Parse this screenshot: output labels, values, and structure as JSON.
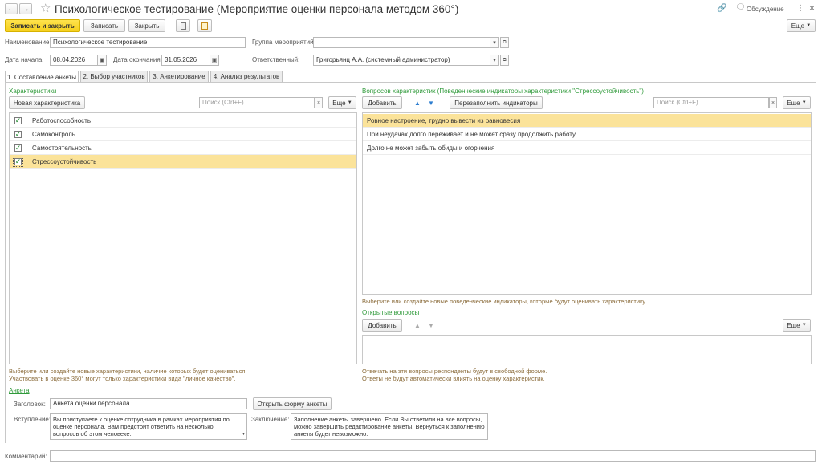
{
  "window": {
    "title": "Психологическое тестирование (Мероприятие оценки персонала методом 360°)",
    "discussion_label": "Обсуждение"
  },
  "toolbar": {
    "save_close_label": "Записать и закрыть",
    "save_label": "Записать",
    "close_label": "Закрыть",
    "more_label": "Еще"
  },
  "form": {
    "name_label": "Наименование:",
    "name_value": "Психологическое тестирование",
    "group_label": "Группа мероприятий:",
    "group_value": "",
    "start_label": "Дата начала:",
    "start_value": "08.04.2026",
    "end_label": "Дата окончания:",
    "end_value": "31.05.2026",
    "responsible_label": "Ответственный:",
    "responsible_value": "Григорьянц А.А. (системный администратор)"
  },
  "tabs": [
    {
      "label": "1. Составление анкеты"
    },
    {
      "label": "2. Выбор участников"
    },
    {
      "label": "3. Анкетирование"
    },
    {
      "label": "4. Анализ результатов"
    }
  ],
  "characteristics": {
    "title": "Характеристики",
    "new_button": "Новая характеристика",
    "search_placeholder": "Поиск (Ctrl+F)",
    "more_label": "Еще",
    "items": [
      {
        "label": "Работоспособность",
        "checked": true
      },
      {
        "label": "Самоконтроль",
        "checked": true
      },
      {
        "label": "Самостоятельность",
        "checked": true
      },
      {
        "label": "Стрессоустойчивость",
        "checked": true
      }
    ],
    "hint_line1": "Выберите или создайте новые характеристики, наличие которых будет оцениваться.",
    "hint_line2": "Участвовать в оценке 360° могут только характеристики вида \"личное качество\"."
  },
  "indicators": {
    "title": "Вопросов характеристик (Поведенческие индикаторы характеристики \"Стрессоустойчивость\")",
    "add_button": "Добавить",
    "refill_button": "Перезаполнить индикаторы",
    "search_placeholder": "Поиск (Ctrl+F)",
    "more_label": "Еще",
    "items": [
      {
        "label": "Ровное настроение, трудно вывести из равновесия"
      },
      {
        "label": "При неудачах долго переживает и не может сразу продолжить работу"
      },
      {
        "label": "Долго не может забыть обиды и огорчения"
      }
    ],
    "hint": "Выберите или создайте новые поведенческие индикаторы, которые будут оценивать характеристику."
  },
  "open_questions": {
    "title": "Открытые вопросы",
    "add_button": "Добавить",
    "more_label": "Еще",
    "hint_line1": "Отвечать на эти вопросы респонденты будут в свободной форме.",
    "hint_line2": "Ответы не будут автоматически влиять на оценку характеристик."
  },
  "survey": {
    "title": "Анкета",
    "header_label": "Заголовок:",
    "header_value": "Анкета оценки персонала",
    "open_form_button": "Открыть форму анкеты",
    "intro_label": "Вступление:",
    "intro_text": "Вы приступаете к оценке сотрудника в рамках мероприятия по оценке персонала. Вам предстоит ответить на несколько вопросов об этом человеке.",
    "conclusion_label": "Заключение:",
    "conclusion_text": "Заполнение анкеты завершено. Если Вы ответили на все вопросы, можно завершить редактирование анкеты. Вернуться к заполнению анкеты будет невозможно."
  },
  "comment": {
    "label": "Комментарий:",
    "value": ""
  }
}
